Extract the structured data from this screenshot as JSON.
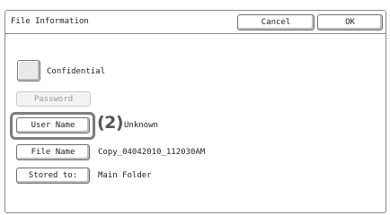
{
  "dialog": {
    "title": "File Information",
    "cancel_label": "Cancel",
    "ok_label": "OK"
  },
  "confidential": {
    "label": "Confidential",
    "checked": false
  },
  "password_button": {
    "label": "Password",
    "enabled": false
  },
  "rows": [
    {
      "button_label": "User Name",
      "value": "Unknown"
    },
    {
      "button_label": "File Name",
      "value": "Copy_04042010_112030AM"
    },
    {
      "button_label": "Stored to:",
      "value": "Main Folder"
    }
  ],
  "callout": {
    "label": "(2)"
  },
  "colors": {
    "border": "#8a8a8a",
    "disabled_text": "#9a9a9a",
    "highlight": "#7d7d7d"
  }
}
